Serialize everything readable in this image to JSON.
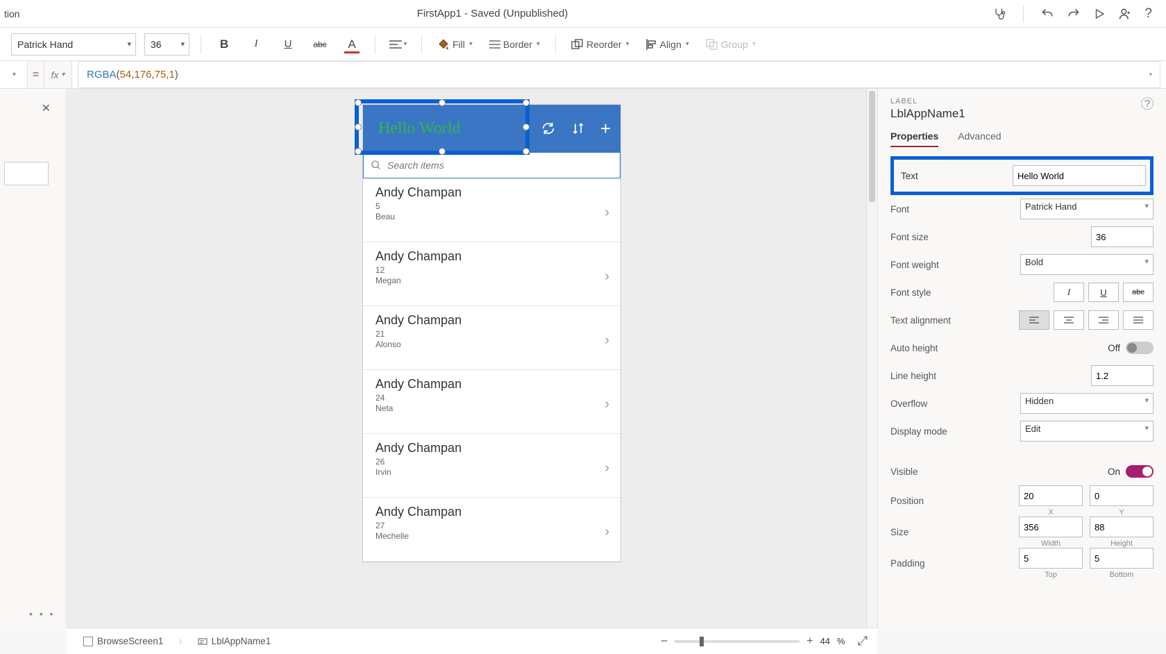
{
  "title": {
    "suffix": "tion",
    "document": "FirstApp1 - Saved (Unpublished)"
  },
  "toolbar": {
    "font": "Patrick Hand",
    "size": "36",
    "fill": "Fill",
    "border": "Border",
    "reorder": "Reorder",
    "align": "Align",
    "group": "Group"
  },
  "formula": {
    "eq": "=",
    "fx": "fx",
    "fn": "RGBA",
    "open": "(",
    "n1": "54",
    "c": ", ",
    "n2": "176",
    "n3": "75",
    "n4": "1",
    "close": ")"
  },
  "canvas": {
    "label_text": "Hello World",
    "search_placeholder": "Search items",
    "items": [
      {
        "title": "Andy Champan",
        "sub": "5",
        "ter": "Beau"
      },
      {
        "title": "Andy Champan",
        "sub": "12",
        "ter": "Megan"
      },
      {
        "title": "Andy Champan",
        "sub": "21",
        "ter": "Alonso"
      },
      {
        "title": "Andy Champan",
        "sub": "24",
        "ter": "Neta"
      },
      {
        "title": "Andy Champan",
        "sub": "26",
        "ter": "Irvin"
      },
      {
        "title": "Andy Champan",
        "sub": "27",
        "ter": "Mechelle"
      }
    ]
  },
  "props": {
    "kind": "LABEL",
    "name": "LblAppName1",
    "tab1": "Properties",
    "tab2": "Advanced",
    "text_label": "Text",
    "text_value": "Hello World",
    "font_label": "Font",
    "font_value": "Patrick Hand",
    "fontsize_label": "Font size",
    "fontsize_value": "36",
    "fontweight_label": "Font weight",
    "fontweight_value": "Bold",
    "fontstyle_label": "Font style",
    "textalign_label": "Text alignment",
    "autoheight_label": "Auto height",
    "autoheight_state": "Off",
    "lineheight_label": "Line height",
    "lineheight_value": "1.2",
    "overflow_label": "Overflow",
    "overflow_value": "Hidden",
    "displaymode_label": "Display mode",
    "displaymode_value": "Edit",
    "visible_label": "Visible",
    "visible_state": "On",
    "position_label": "Position",
    "position_x": "20",
    "position_y": "0",
    "position_x_l": "X",
    "position_y_l": "Y",
    "size_label": "Size",
    "size_w": "356",
    "size_h": "88",
    "size_w_l": "Width",
    "size_h_l": "Height",
    "padding_label": "Padding",
    "padding_t": "5",
    "padding_b": "5",
    "padding_t_l": "Top",
    "padding_b_l": "Bottom"
  },
  "bottom": {
    "crumb1": "BrowseScreen1",
    "crumb2": "LblAppName1",
    "zoom": "44",
    "pct": "%"
  }
}
